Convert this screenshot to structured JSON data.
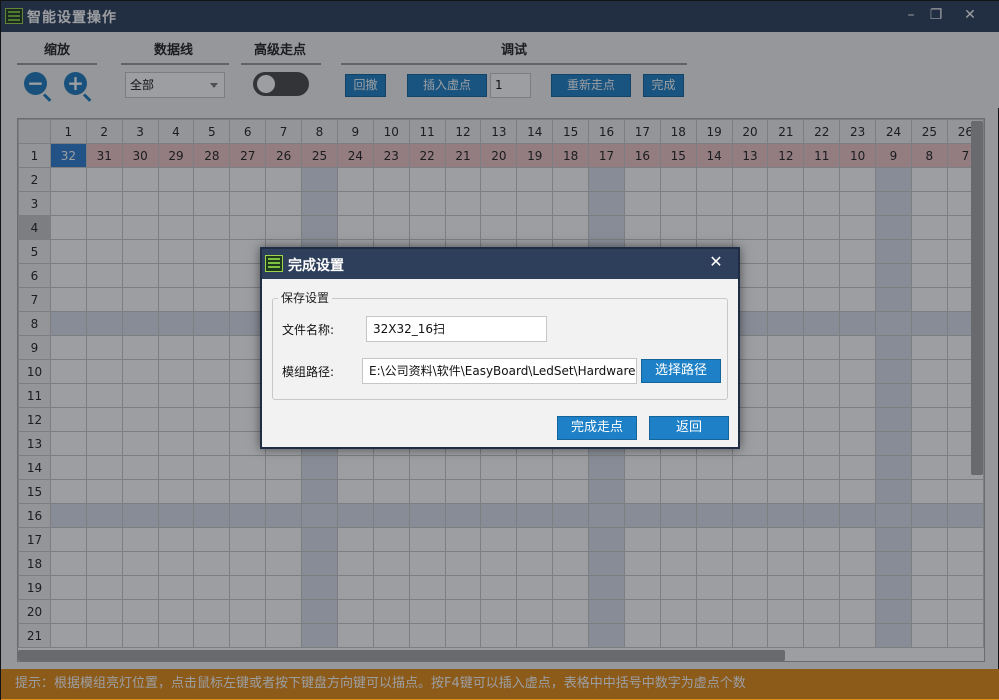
{
  "window": {
    "title": "智能设置操作",
    "minimize_glyph": "–",
    "maximize_glyph": "❐",
    "close_glyph": "✕"
  },
  "toolbar": {
    "zoom_label": "缩放",
    "dataline_label": "数据线",
    "advanced_label": "高级走点",
    "debug_label": "调试",
    "zoom_out_glyph": "−",
    "zoom_in_glyph": "+",
    "dataline_value": "全部",
    "advanced_enabled": false,
    "undo_label": "回撤",
    "insert_label": "插入虚点",
    "insert_count": "1",
    "restart_label": "重新走点",
    "finish_label": "完成"
  },
  "grid": {
    "columns": [
      "1",
      "2",
      "3",
      "4",
      "5",
      "6",
      "7",
      "8",
      "9",
      "10",
      "11",
      "12",
      "13",
      "14",
      "15",
      "16",
      "17",
      "18",
      "19",
      "20",
      "21",
      "22",
      "23",
      "24",
      "25",
      "26"
    ],
    "rows": [
      "1",
      "2",
      "3",
      "4",
      "5",
      "6",
      "7",
      "8",
      "9",
      "10",
      "11",
      "12",
      "13",
      "14",
      "15",
      "16",
      "17",
      "18",
      "19",
      "20",
      "21"
    ],
    "row1_values": [
      "32",
      "31",
      "30",
      "29",
      "28",
      "27",
      "26",
      "25",
      "24",
      "23",
      "22",
      "21",
      "20",
      "19",
      "18",
      "17",
      "16",
      "15",
      "14",
      "13",
      "12",
      "11",
      "10",
      "9",
      "8",
      "7"
    ],
    "selected_row": "4"
  },
  "status": {
    "text": "提示：根据模组亮灯位置，点击鼠标左键或者按下键盘方向键可以描点。按F4键可以插入虚点，表格中中括号中数字为虚点个数"
  },
  "dialog": {
    "title": "完成设置",
    "close_glyph": "✕",
    "group_label": "保存设置",
    "filename_label": "文件名称:",
    "filename_value": "32X32_16扫",
    "path_label": "模组路径:",
    "path_value": "E:\\公司资料\\软件\\EasyBoard\\LedSet\\Hardware",
    "choose_path_label": "选择路径",
    "complete_label": "完成走点",
    "back_label": "返回"
  },
  "colors": {
    "titlebar": "#2e3f5c",
    "button": "#1e80c6",
    "status_bar": "#e48a16",
    "row1_highlight": "#f2c7c7",
    "current_cell": "#2f7fd0"
  }
}
